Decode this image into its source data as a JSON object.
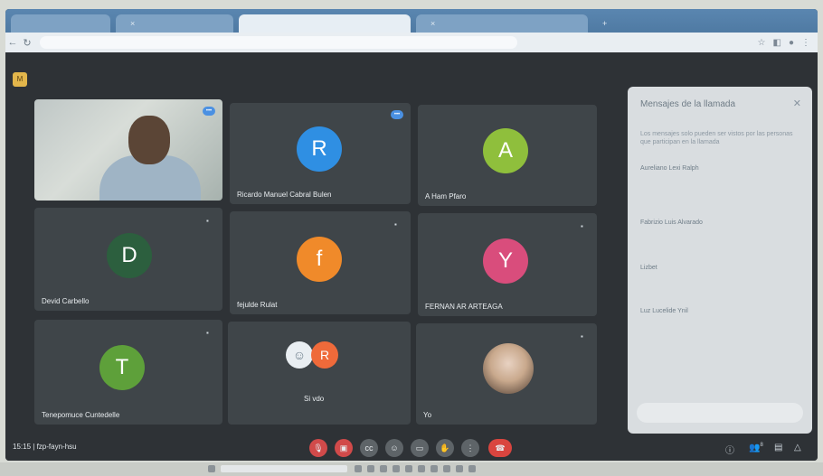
{
  "browser": {
    "tabs": [
      {
        "label": "",
        "active": false
      },
      {
        "label": "",
        "active": false
      },
      {
        "label": "",
        "active": true
      },
      {
        "label": "",
        "active": false
      }
    ],
    "url": ""
  },
  "meet": {
    "logo_icon": "meet-logo-icon",
    "tiles": [
      {
        "name": "",
        "type": "video",
        "speaking": true
      },
      {
        "name": "Ricardo Manuel Cabral Bulen",
        "initial": "R",
        "color": "#2f8fe3",
        "speaking": true
      },
      {
        "name": "A Ham Pfaro",
        "initial": "A",
        "color": "#8fbf3c"
      },
      {
        "name": "Devid Carbello",
        "initial": "D",
        "color": "#2c5f3e"
      },
      {
        "name": "fejulde Rulat",
        "initial": "f",
        "color": "#f08a2a"
      },
      {
        "name": "FERNAN AR ARTEAGA",
        "initial": "Y",
        "color": "#d94d7c"
      },
      {
        "name": "Tenepomuce Cuntedelle",
        "initial": "T",
        "color": "#5ea03a"
      },
      {
        "name": "Si vdo",
        "initial": "R",
        "color": "#ef6a3a"
      },
      {
        "name": "Yo",
        "type": "photo"
      }
    ]
  },
  "chat_panel": {
    "title": "Mensajes de la llamada",
    "close_icon": "close-icon",
    "notice": "Los mensajes solo pueden ser vistos por las personas que participan en la llamada",
    "messages": [
      {
        "sender": "Aureliano Lexi Ralph",
        "text": "",
        "link": ""
      },
      {
        "sender": "Fabrizio Luis Alvarado",
        "text": "",
        "link": ""
      },
      {
        "sender": "Lizbet",
        "text": "",
        "link": ""
      },
      {
        "sender": "Luz Lucelide Ynil",
        "text": "",
        "link": ""
      }
    ],
    "input_placeholder": ""
  },
  "bottom_bar": {
    "time": "15:15",
    "meeting_code": "fzp-fayn-hsu",
    "controls": [
      "mic-off-icon",
      "camera-off-icon",
      "captions-icon",
      "emoji-icon",
      "present-icon",
      "raise-hand-icon",
      "more-icon",
      "hangup-icon"
    ],
    "right_controls": [
      "info-icon",
      "people-icon",
      "chat-icon",
      "activities-icon"
    ],
    "participant_count": "8"
  }
}
